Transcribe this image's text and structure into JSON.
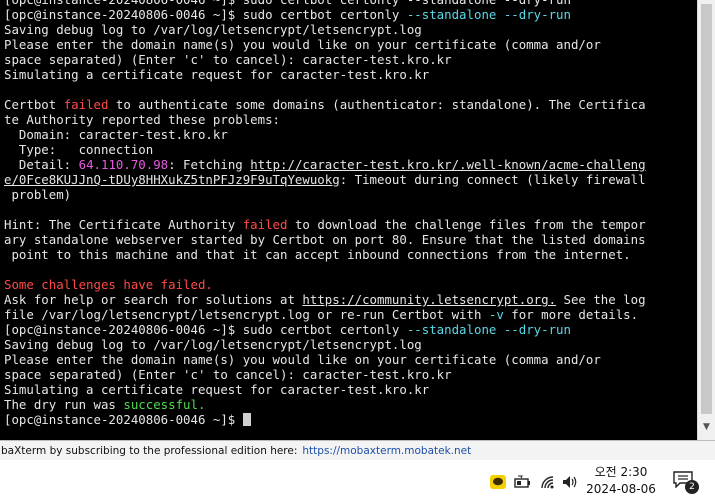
{
  "terminal": {
    "lines": [
      [
        {
          "t": "[opc@instance-20240806-0046 ~]$ sudo certbot certonly --standalone --dry-run"
        }
      ],
      [
        {
          "t": "[opc@instance-20240806-0046 ~]$ sudo certbot certonly "
        },
        {
          "t": "--standalone --dry-run",
          "c": "cyan"
        }
      ],
      [
        {
          "t": "Saving debug log to /var/log/letsencrypt/letsencrypt.log"
        }
      ],
      [
        {
          "t": "Please enter the domain name(s) you would like on your certificate (comma and/or"
        }
      ],
      [
        {
          "t": "space separated) (Enter 'c' to cancel): caracter-test.kro.kr"
        }
      ],
      [
        {
          "t": "Simulating a certificate request for caracter-test.kro.kr"
        }
      ],
      [],
      [
        {
          "t": "Certbot "
        },
        {
          "t": "failed",
          "c": "red"
        },
        {
          "t": " to authenticate some domains (authenticator: standalone). The Certifica"
        }
      ],
      [
        {
          "t": "te Authority reported these problems:"
        }
      ],
      [
        {
          "t": "  Domain: caracter-test.kro.kr"
        }
      ],
      [
        {
          "t": "  Type:   connection"
        }
      ],
      [
        {
          "t": "  Detail: "
        },
        {
          "t": "64.110.70.98",
          "c": "magenta"
        },
        {
          "t": ": Fetching "
        },
        {
          "t": "http://caracter-test.kro.kr/.well-known/acme-challeng",
          "c": "link"
        }
      ],
      [
        {
          "t": "e/0Fce8KUJJnQ-tDUy8HHXukZ5tnPFJz9F9uTqYewuokg",
          "c": "link"
        },
        {
          "t": ": Timeout during connect (likely firewall"
        }
      ],
      [
        {
          "t": " problem)"
        }
      ],
      [],
      [
        {
          "t": "Hint: The Certificate Authority "
        },
        {
          "t": "failed",
          "c": "red"
        },
        {
          "t": " to download the challenge files from the tempor"
        }
      ],
      [
        {
          "t": "ary standalone webserver started by Certbot on port 80. Ensure that the listed domains"
        }
      ],
      [
        {
          "t": " point to this machine and that it can accept inbound connections from the internet."
        }
      ],
      [],
      [
        {
          "t": "Some challenges have failed.",
          "c": "red"
        }
      ],
      [
        {
          "t": "Ask for help or search for solutions at "
        },
        {
          "t": "https://community.letsencrypt.org.",
          "c": "link"
        },
        {
          "t": " See the log"
        }
      ],
      [
        {
          "t": "file /var/log/letsencrypt/letsencrypt.log or re-run Certbot with "
        },
        {
          "t": "-v",
          "c": "cyan"
        },
        {
          "t": " for more details."
        }
      ],
      [
        {
          "t": "[opc@instance-20240806-0046 ~]$ sudo certbot certonly "
        },
        {
          "t": "--standalone --dry-run",
          "c": "cyan"
        }
      ],
      [
        {
          "t": "Saving debug log to /var/log/letsencrypt/letsencrypt.log"
        }
      ],
      [
        {
          "t": "Please enter the domain name(s) you would like on your certificate (comma and/or"
        }
      ],
      [
        {
          "t": "space separated) (Enter 'c' to cancel): caracter-test.kro.kr"
        }
      ],
      [
        {
          "t": "Simulating a certificate request for caracter-test.kro.kr"
        }
      ],
      [
        {
          "t": "The dry run was "
        },
        {
          "t": "successful.",
          "c": "green"
        }
      ],
      [
        {
          "t": "[opc@instance-20240806-0046 ~]$ "
        }
      ]
    ]
  },
  "statusbar": {
    "text": "baXterm by subscribing to the professional edition here:",
    "link": "https://mobaxterm.mobatek.net"
  },
  "taskbar": {
    "icons": [
      "kakaotalk-icon",
      "battery-icon",
      "wifi-icon",
      "volume-icon"
    ],
    "time": "오전 2:30",
    "date": "2024-08-06",
    "notification_count": "2"
  }
}
